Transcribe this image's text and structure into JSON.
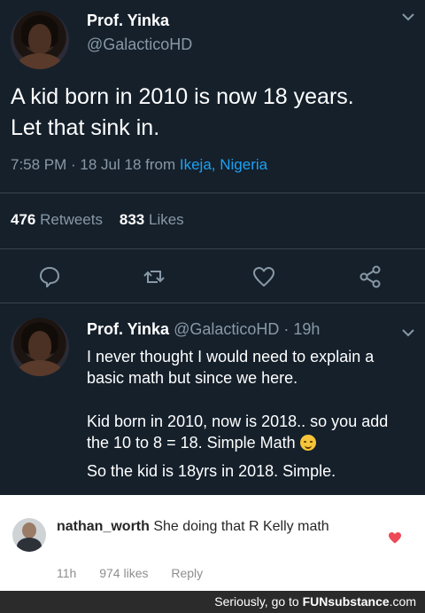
{
  "tweet": {
    "author_name": "Prof. Yinka",
    "author_handle": "@GalacticoHD",
    "text": "A kid born in 2010 is now 18 years. Let that sink in.",
    "time": "7:58 PM · 18 Jul 18 from ",
    "location": "Ikeja, Nigeria",
    "retweets_count": "476",
    "retweets_label": "Retweets",
    "likes_count": "833",
    "likes_label": "Likes",
    "actions": [
      "reply-icon",
      "retweet-icon",
      "like-icon",
      "share-icon"
    ]
  },
  "reply": {
    "author_name": "Prof. Yinka",
    "author_meta": "@GalacticoHD · 19h",
    "line1": "I never thought I would need to explain a basic math but since we here.",
    "line2": "Kid born in 2010, now is 2018.. so you add the 10 to 8 = 18. Simple Math",
    "line3": "So the kid is 18yrs in 2018. Simple."
  },
  "comment": {
    "username": "nathan_worth",
    "text": "She doing that R Kelly math",
    "time": "11h",
    "likes": "974 likes",
    "reply_label": "Reply"
  },
  "footer": {
    "prefix": "Seriously, go to ",
    "brand": "FUNsubstance",
    "suffix": ".com"
  },
  "colors": {
    "background": "#15202b",
    "link": "#1da1f2",
    "muted": "#8899a6",
    "heart": "#ed4956"
  }
}
